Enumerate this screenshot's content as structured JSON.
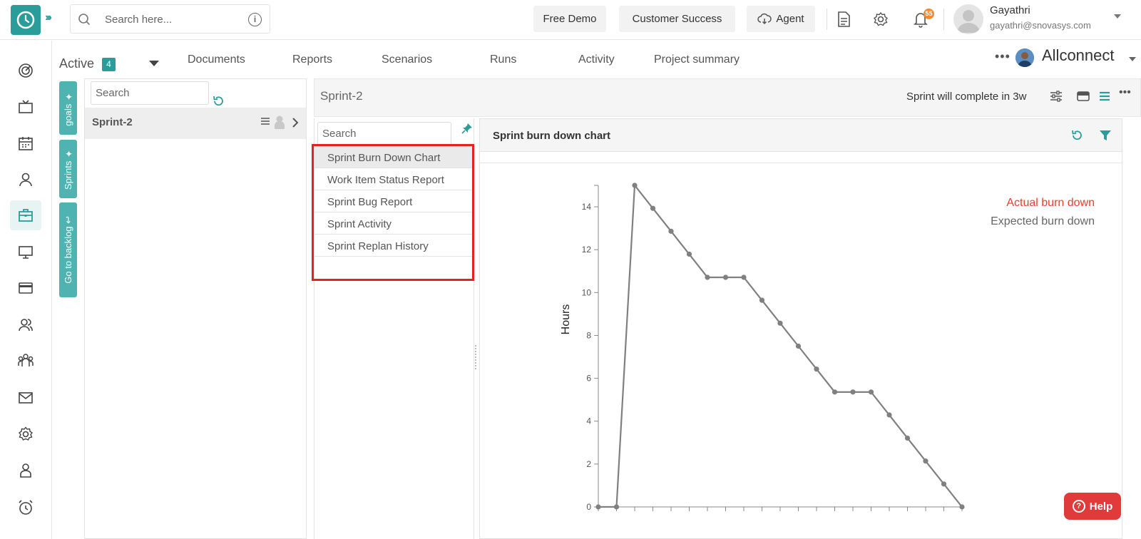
{
  "topbar": {
    "search_placeholder": "Search here...",
    "free_demo": "Free Demo",
    "customer_success": "Customer Success",
    "agent": "Agent",
    "notification_count": "55",
    "user_name": "Gayathri",
    "user_email": "gayathri@snovasys.com"
  },
  "project": {
    "status_label": "Active",
    "status_count": "4",
    "tabs": [
      "Documents",
      "Reports",
      "Scenarios",
      "Runs",
      "Activity",
      "Project summary"
    ],
    "name": "Allconnect"
  },
  "side_tabs": [
    "goals",
    "Sprints",
    "Go to backlog"
  ],
  "sprint_panel": {
    "search_placeholder": "Search",
    "sprints": [
      {
        "name": "Sprint-2"
      }
    ]
  },
  "main": {
    "title": "Sprint-2",
    "status": "Sprint will complete in 3w"
  },
  "report_list": {
    "search_placeholder": "Search",
    "items": [
      "Sprint Burn Down Chart",
      "Work Item Status Report",
      "Sprint Bug Report",
      "Sprint Activity",
      "Sprint Replan History"
    ],
    "selected_index": 0
  },
  "chart_panel": {
    "title": "Sprint burn down chart"
  },
  "chart_data": {
    "type": "line",
    "ylabel": "Hours",
    "ylim": [
      0,
      15
    ],
    "yticks": [
      0,
      2,
      4,
      6,
      8,
      10,
      12,
      14
    ],
    "legend": [
      {
        "name": "Actual burn down",
        "color": "#e8402e"
      },
      {
        "name": "Expected burn down",
        "color": "#666666"
      }
    ],
    "legend_position": "top-right",
    "series": [
      {
        "name": "Expected burn down",
        "color": "#808080",
        "values": [
          0,
          0,
          15,
          13.93,
          12.86,
          11.79,
          10.71,
          10.71,
          10.71,
          9.64,
          8.57,
          7.5,
          6.43,
          5.36,
          5.36,
          5.36,
          4.29,
          3.21,
          2.14,
          1.07,
          0
        ]
      }
    ]
  },
  "help": {
    "label": "Help"
  },
  "colors": {
    "accent": "#2a9d9b",
    "highlight": "#e32222",
    "help": "#e03a3a"
  }
}
